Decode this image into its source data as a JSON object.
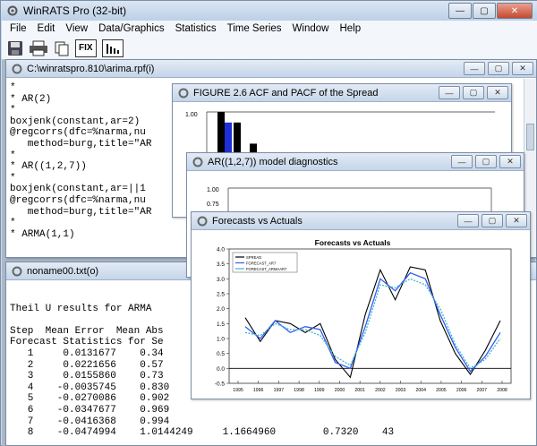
{
  "app": {
    "title": "WinRATS Pro (32-bit)",
    "menu": [
      "File",
      "Edit",
      "View",
      "Data/Graphics",
      "Statistics",
      "Time Series",
      "Window",
      "Help"
    ],
    "toolbar": {
      "fix_label": "FIX"
    }
  },
  "editor": {
    "title": "C:\\winratspro.810\\arima.rpf(i)",
    "lines": [
      "*",
      "* AR(2)",
      "*",
      "boxjenk(constant,ar=2)",
      "@regcorrs(dfc=%narma,nu",
      "   method=burg,title=\"AR",
      "*",
      "* AR((1,2,7))",
      "*",
      "boxjenk(constant,ar=||1",
      "@regcorrs(dfc=%narma,nu",
      "   method=burg,title=\"AR",
      "*",
      "* ARMA(1,1)"
    ]
  },
  "output": {
    "title": "noname00.txt(o)",
    "lines": [
      "",
      "Theil U results for ARMA",
      "",
      "Step  Mean Error  Mean Abs",
      "Forecast Statistics for Se",
      "   1     0.0131677    0.34",
      "   2     0.0221656    0.57",
      "   3     0.0155860    0.73",
      "   4    -0.0035745    0.830",
      "   5    -0.0270086    0.902",
      "   6    -0.0347677    0.969",
      "   7    -0.0416368    0.994",
      "   8    -0.0474994    1.0144249     1.1664960        0.7320    43"
    ]
  },
  "acf_window": {
    "title": "FIGURE 2.6 ACF and PACF of the Spread",
    "y_tick": "1.00",
    "chart_data": {
      "type": "bar",
      "values_acf": [
        1.0,
        0.9,
        0.7,
        0.45,
        0.2
      ],
      "values_pacf": [
        0.9,
        0.45
      ],
      "ylim": [
        0,
        1
      ]
    }
  },
  "diag_window": {
    "title": "AR((1,2,7)) model diagnostics",
    "y_tick": "1.00",
    "second_tick": "0.75"
  },
  "forecast_window": {
    "title": "Forecasts vs Actuals",
    "chart_data": {
      "type": "line",
      "title": "Forecasts vs Actuals",
      "ylim": [
        -0.5,
        4.0
      ],
      "yticks": [
        "4.0",
        "3.5",
        "3.0",
        "2.5",
        "2.0",
        "1.5",
        "1.0",
        "0.5",
        "0.0",
        "-0.5"
      ],
      "xticks": [
        "1995",
        "1996",
        "1997",
        "1998",
        "1999",
        "2000",
        "2001",
        "2002",
        "2003",
        "2004",
        "2005",
        "2006",
        "2007",
        "2008"
      ],
      "legend": [
        "SPREAD",
        "FORECAST_AR7",
        "FORECAST_ARMAAR7"
      ],
      "series_colors": [
        "#000000",
        "#2e5ef5",
        "#3fb3c9"
      ],
      "series": [
        {
          "values": [
            1.7,
            0.9,
            1.6,
            1.5,
            1.2,
            1.5,
            0.3,
            -0.3,
            1.8,
            3.3,
            2.3,
            3.4,
            3.3,
            1.6,
            0.5,
            -0.2,
            0.6,
            1.6
          ]
        },
        {
          "values": [
            1.4,
            1.0,
            1.6,
            1.2,
            1.4,
            1.3,
            0.2,
            0.0,
            1.4,
            3.0,
            2.6,
            3.2,
            3.0,
            1.8,
            0.7,
            -0.1,
            0.4,
            1.2
          ]
        },
        {
          "values": [
            1.2,
            1.1,
            1.5,
            1.3,
            1.3,
            1.1,
            0.4,
            0.1,
            1.2,
            2.8,
            2.7,
            3.0,
            2.8,
            2.0,
            0.8,
            0.0,
            0.3,
            1.0
          ]
        }
      ]
    }
  }
}
